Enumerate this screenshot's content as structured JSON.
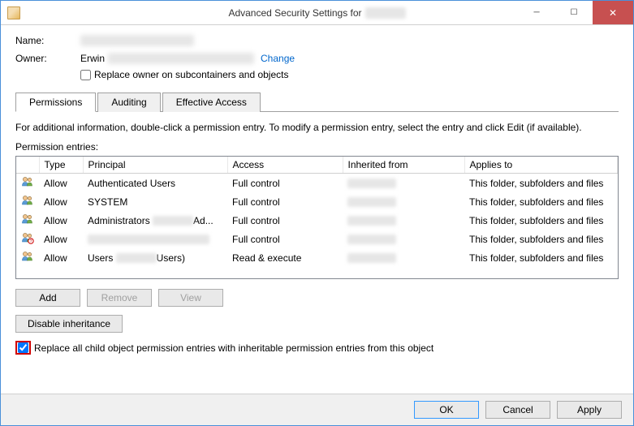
{
  "window": {
    "title_prefix": "Advanced Security Settings for"
  },
  "labels": {
    "name": "Name:",
    "owner": "Owner:",
    "owner_name": "Erwin",
    "change": "Change",
    "replace_owner": "Replace owner on subcontainers and objects",
    "info": "For additional information, double-click a permission entry. To modify a permission entry, select the entry and click Edit (if available).",
    "perm_entries": "Permission entries:",
    "replace_child": "Replace all child object permission entries with inheritable permission entries from this object"
  },
  "tabs": {
    "permissions": "Permissions",
    "auditing": "Auditing",
    "effective": "Effective Access"
  },
  "columns": {
    "type": "Type",
    "principal": "Principal",
    "access": "Access",
    "inherited": "Inherited from",
    "applies": "Applies to"
  },
  "entries": [
    {
      "type": "Allow",
      "principal": "Authenticated Users",
      "principal_blur": "",
      "access": "Full control",
      "applies": "This folder, subfolders and files",
      "locked": false
    },
    {
      "type": "Allow",
      "principal": "SYSTEM",
      "principal_blur": "",
      "access": "Full control",
      "applies": "This folder, subfolders and files",
      "locked": false
    },
    {
      "type": "Allow",
      "principal": "Administrators",
      "principal_blur": "Ad...",
      "access": "Full control",
      "applies": "This folder, subfolders and files",
      "locked": false
    },
    {
      "type": "Allow",
      "principal": "",
      "principal_blur": "",
      "access": "Full control",
      "applies": "This folder, subfolders and files",
      "locked": true
    },
    {
      "type": "Allow",
      "principal": "Users",
      "principal_blur": "Users)",
      "access": "Read & execute",
      "applies": "This folder, subfolders and files",
      "locked": false
    }
  ],
  "buttons": {
    "add": "Add",
    "remove": "Remove",
    "view": "View",
    "disable_inh": "Disable inheritance",
    "ok": "OK",
    "cancel": "Cancel",
    "apply": "Apply"
  },
  "state": {
    "replace_owner_checked": false,
    "replace_child_checked": true
  }
}
